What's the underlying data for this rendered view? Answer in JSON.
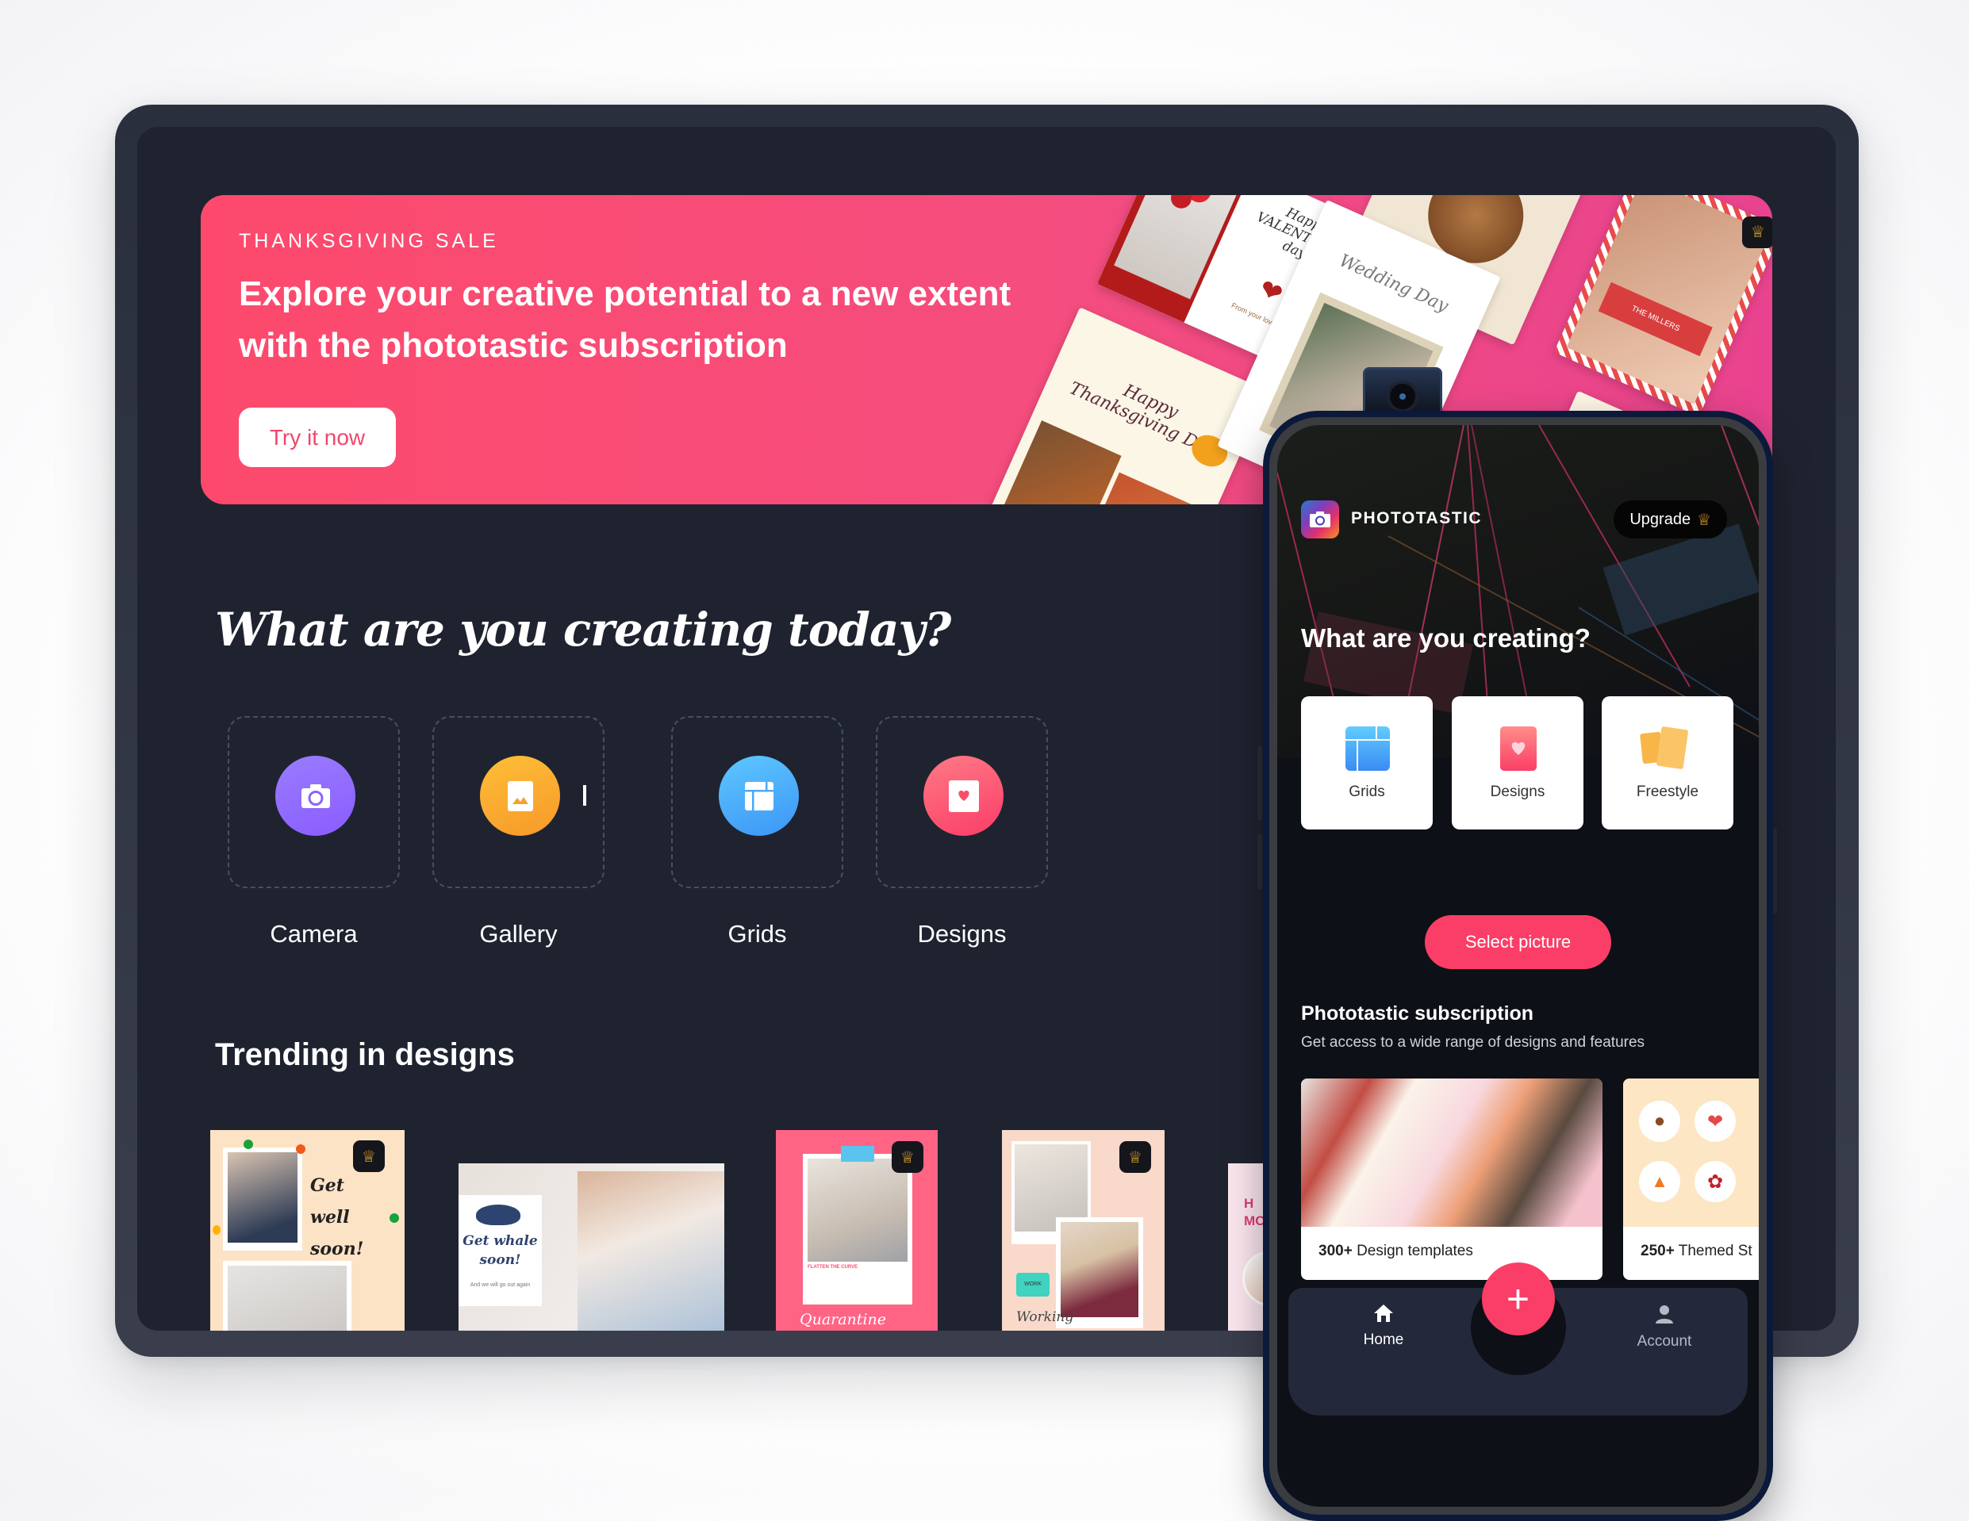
{
  "banner": {
    "eyebrow": "THANKSGIVING SALE",
    "title": "Explore your creative potential to a new extent with the phototastic subscription",
    "cta_label": "Try it now",
    "gradient": [
      "#fd4a6c",
      "#e9438f"
    ],
    "collage_cards": [
      {
        "title": "Happy VALENTINE'S day",
        "subtitle": "From your love ADAM"
      },
      {
        "title": "Happy Thanksgiving Day"
      },
      {
        "title": "Wedding Day"
      },
      {
        "title": "THE MILLERS"
      }
    ]
  },
  "creating": {
    "title": "What are you creating today?",
    "tools": [
      {
        "label": "Camera",
        "icon": "camera-icon",
        "color": "#8b6cff"
      },
      {
        "label": "Gallery",
        "icon": "image-icon",
        "color": "#fbab2c"
      },
      {
        "label": "Grids",
        "icon": "grid-icon",
        "color": "#45a9f8"
      },
      {
        "label": "Designs",
        "icon": "heart-card-icon",
        "color": "#fc4d6a"
      }
    ]
  },
  "trending": {
    "title": "Trending in designs",
    "cards": [
      {
        "text": "Get well soon!",
        "premium": true
      },
      {
        "text": "Get whale soon!",
        "subtext": "And we will go out again",
        "premium": false
      },
      {
        "text": "Quarantine times",
        "subtext": "FLATTEN THE CURVE",
        "premium": true
      },
      {
        "text": "Working",
        "subtext": "WORK",
        "premium": true
      },
      {
        "text": "H MO",
        "premium": false
      }
    ]
  },
  "phone": {
    "brand": "PHOTOTASTIC",
    "upgrade_label": "Upgrade",
    "title": "What are you creating?",
    "tiles": [
      {
        "label": "Grids",
        "icon": "grid-icon"
      },
      {
        "label": "Designs",
        "icon": "heart-card-icon"
      },
      {
        "label": "Freestyle",
        "icon": "freestyle-cards-icon"
      }
    ],
    "select_label": "Select picture",
    "subscription": {
      "title": "Phototastic subscription",
      "description": "Get access to a wide range of designs and features",
      "cards": [
        {
          "count": "300+",
          "label": "Design templates"
        },
        {
          "count": "250+",
          "label": "Themed St"
        }
      ]
    },
    "nav": {
      "home_label": "Home",
      "account_label": "Account",
      "fab_label": "+"
    },
    "accent": "#fb3e67"
  }
}
